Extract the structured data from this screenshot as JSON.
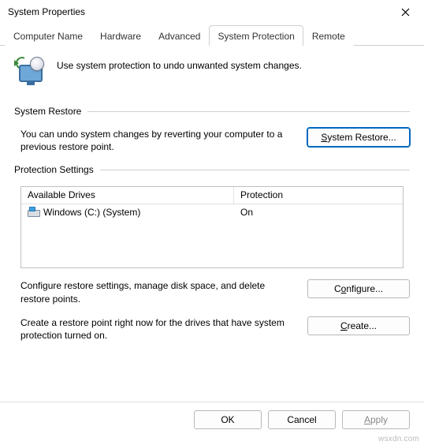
{
  "window": {
    "title": "System Properties"
  },
  "tabs": {
    "computer_name": "Computer Name",
    "hardware": "Hardware",
    "advanced": "Advanced",
    "system_protection": "System Protection",
    "remote": "Remote"
  },
  "intro": {
    "text": "Use system protection to undo unwanted system changes."
  },
  "system_restore": {
    "heading": "System Restore",
    "description": "You can undo system changes by reverting your computer to a previous restore point.",
    "button_prefix": "",
    "button_mnemonic": "S",
    "button_suffix": "ystem Restore..."
  },
  "protection_settings": {
    "heading": "Protection Settings",
    "columns": {
      "drives": "Available Drives",
      "protection": "Protection"
    },
    "rows": [
      {
        "drive": "Windows (C:) (System)",
        "protection": "On"
      }
    ],
    "configure_text": "Configure restore settings, manage disk space, and delete restore points.",
    "configure_btn_prefix": "C",
    "configure_btn_mnemonic": "o",
    "configure_btn_suffix": "nfigure...",
    "create_text": "Create a restore point right now for the drives that have system protection turned on.",
    "create_btn_prefix": "",
    "create_btn_mnemonic": "C",
    "create_btn_suffix": "reate..."
  },
  "footer": {
    "ok": "OK",
    "cancel": "Cancel",
    "apply_mnemonic": "A",
    "apply_suffix": "pply"
  },
  "watermark": "wsxdn.com"
}
